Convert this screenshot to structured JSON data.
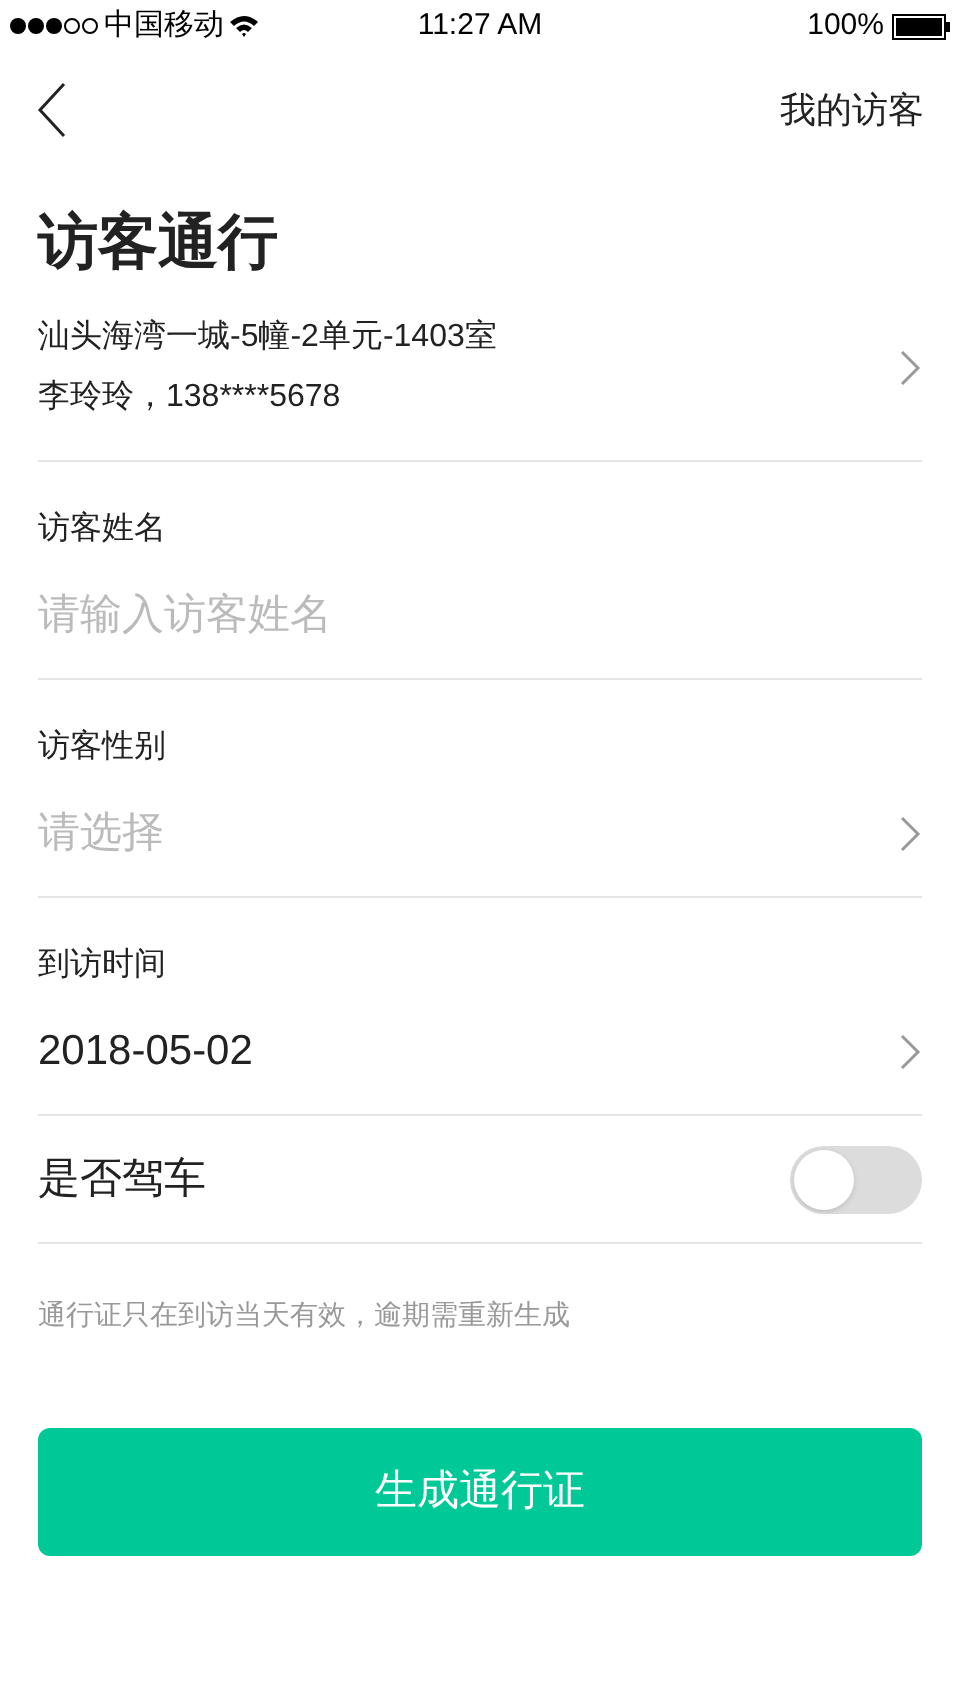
{
  "status_bar": {
    "carrier": "中国移动",
    "time": "11:27 AM",
    "battery": "100%"
  },
  "nav": {
    "action": "我的访客"
  },
  "title": "访客通行",
  "address": {
    "line1": "汕头海湾一城-5幢-2单元-1403室",
    "line2": "李玲玲，138****5678"
  },
  "fields": [
    {
      "kind": "input",
      "label": "访客姓名",
      "placeholder": "请输入访客姓名"
    },
    {
      "kind": "select",
      "label": "访客性别",
      "placeholder": "请选择"
    },
    {
      "kind": "select",
      "label": "到访时间",
      "value": "2018-05-02"
    }
  ],
  "drive": {
    "label": "是否驾车",
    "on": false
  },
  "note": "通行证只在到访当天有效，逾期需重新生成",
  "submit": "生成通行证"
}
